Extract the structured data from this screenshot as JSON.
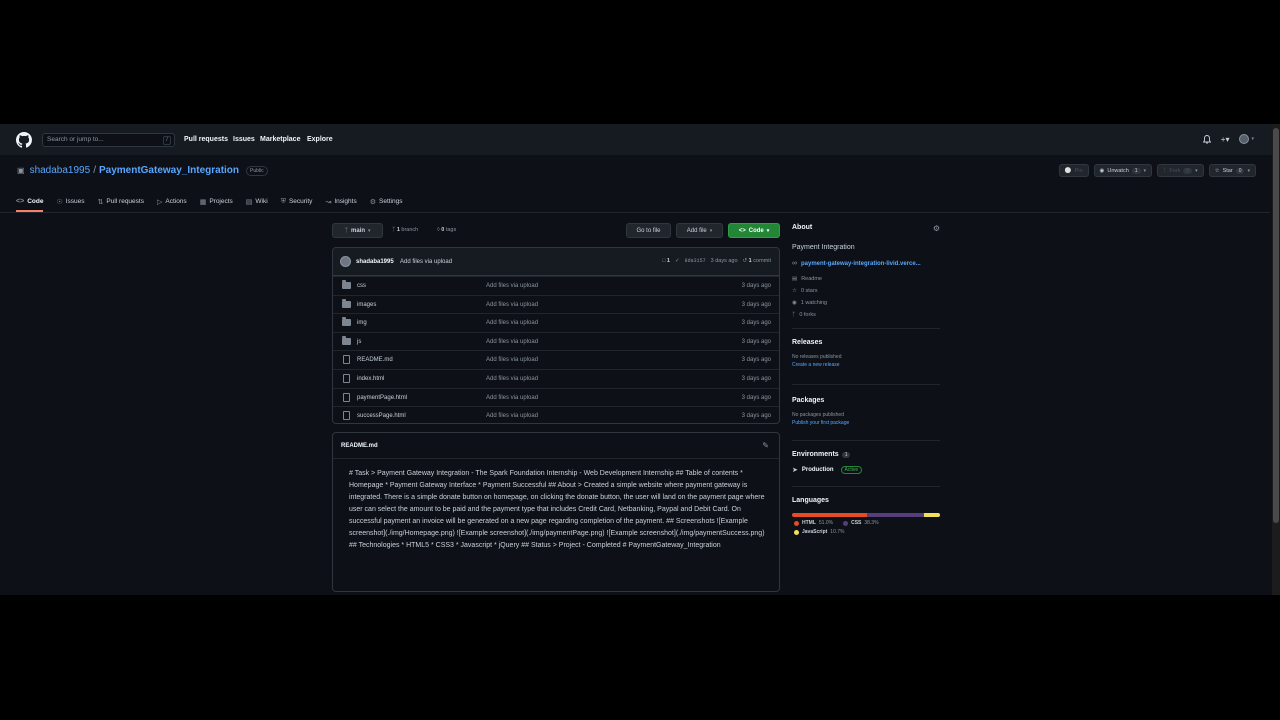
{
  "header": {
    "search_placeholder": "Search or jump to...",
    "search_shortcut": "/",
    "nav": [
      "Pull requests",
      "Issues",
      "Marketplace",
      "Explore"
    ]
  },
  "repo": {
    "owner": "shadaba1995",
    "separator": "/",
    "name": "PaymentGateway_Integration",
    "visibility": "Public",
    "pin_label": "Pin",
    "unwatch_label": "Unwatch",
    "watch_count": "1",
    "fork_label": "Fork",
    "fork_count": "0",
    "star_label": "Star",
    "star_count": "0"
  },
  "tabs": [
    {
      "label": "Code",
      "icon": "code-icon"
    },
    {
      "label": "Issues",
      "icon": "issue-icon"
    },
    {
      "label": "Pull requests",
      "icon": "pull-request-icon"
    },
    {
      "label": "Actions",
      "icon": "actions-icon"
    },
    {
      "label": "Projects",
      "icon": "projects-icon"
    },
    {
      "label": "Wiki",
      "icon": "wiki-icon"
    },
    {
      "label": "Security",
      "icon": "shield-icon"
    },
    {
      "label": "Insights",
      "icon": "graph-icon"
    },
    {
      "label": "Settings",
      "icon": "gear-icon"
    }
  ],
  "branch": {
    "name": "main",
    "branches_count": "1",
    "branches_label": "branch",
    "tags_count": "0",
    "tags_label": "tags",
    "go_to_file": "Go to file",
    "add_file": "Add file",
    "code": "Code"
  },
  "commit": {
    "author": "shadaba1995",
    "message": "Add files via upload",
    "comment_count": "1",
    "hash": "8da3157",
    "time": "3 days ago",
    "commits_count": "1",
    "commits_label": "commit"
  },
  "files": [
    {
      "name": "css",
      "type": "folder",
      "message": "Add files via upload",
      "date": "3 days ago"
    },
    {
      "name": "images",
      "type": "folder",
      "message": "Add files via upload",
      "date": "3 days ago"
    },
    {
      "name": "img",
      "type": "folder",
      "message": "Add files via upload",
      "date": "3 days ago"
    },
    {
      "name": "js",
      "type": "folder",
      "message": "Add files via upload",
      "date": "3 days ago"
    },
    {
      "name": "README.md",
      "type": "file",
      "message": "Add files via upload",
      "date": "3 days ago"
    },
    {
      "name": "index.html",
      "type": "file",
      "message": "Add files via upload",
      "date": "3 days ago"
    },
    {
      "name": "paymentPage.html",
      "type": "file",
      "message": "Add files via upload",
      "date": "3 days ago"
    },
    {
      "name": "successPage.html",
      "type": "file",
      "message": "Add files via upload",
      "date": "3 days ago"
    }
  ],
  "readme": {
    "title": "README.md",
    "body": "# Task > Payment Gateway Integration - The Spark Foundation Internship - Web Development Internship ## Table of contents * Homepage * Payment Gateway Interface * Payment Successful ## About > Created a simple website where payment gateway is integrated. There is a simple donate button on homepage, on clicking the donate button, the user will land on the payment page where user can select the amount to be paid and the payment type that includes Credit Card, Netbanking, Paypal and Debit Card. On successful payment an invoice will be generated on a new page regarding completion of the payment. ## Screenshots ![Example screenshot](./img/Homepage.png) ![Example screenshot](./img/paymentPage.png) ![Example screenshot](./img/paymentSuccess.png) ## Technologies * HTML5 * CSS3 * Javascript * jQuery ## Status > Project - Completed # PaymentGateway_Integration"
  },
  "about": {
    "heading": "About",
    "description": "Payment Integration",
    "link": "payment-gateway-integration-livid.verce...",
    "readme": "Readme",
    "stars": "0 stars",
    "watching": "1 watching",
    "forks": "0 forks"
  },
  "releases": {
    "heading": "Releases",
    "none": "No releases published",
    "create": "Create a new release"
  },
  "packages": {
    "heading": "Packages",
    "none": "No packages published",
    "publish": "Publish your first package"
  },
  "environments": {
    "heading": "Environments",
    "count": "1",
    "name": "Production",
    "status": "Active"
  },
  "languages": {
    "heading": "Languages",
    "items": [
      {
        "name": "HTML",
        "percent": "51.0%",
        "value": 51.0,
        "color": "#e34c26"
      },
      {
        "name": "CSS",
        "percent": "38.3%",
        "value": 38.3,
        "color": "#563d7c"
      },
      {
        "name": "JavaScript",
        "percent": "10.7%",
        "value": 10.7,
        "color": "#f1e05a"
      }
    ]
  },
  "colors": {
    "accent_link": "#58a6ff",
    "primary_button": "#238636",
    "active_tab": "#f78166"
  }
}
